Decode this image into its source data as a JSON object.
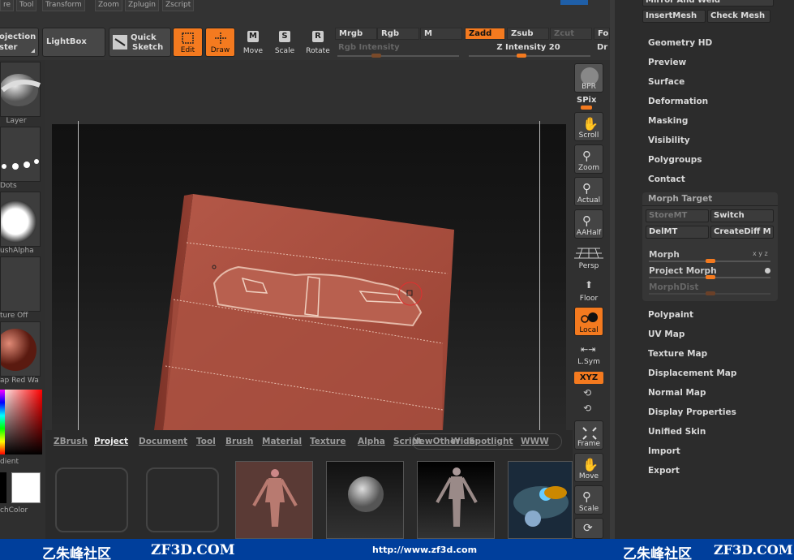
{
  "menu": {
    "items": [
      "re",
      "Tool",
      "Transform",
      "Zoom",
      "Zplugin",
      "Zscript"
    ]
  },
  "toolbar": {
    "projection_label_1": "ojection",
    "projection_label_2": "ster",
    "lightbox": "LightBox",
    "quick_sketch_1": "Quick",
    "quick_sketch_2": "Sketch",
    "edit": "Edit",
    "draw": "Draw",
    "move": "Move",
    "scale": "Scale",
    "rotate": "Rotate",
    "mrgb": "Mrgb",
    "rgb": "Rgb",
    "m": "M",
    "zadd": "Zadd",
    "zsub": "Zsub",
    "zcut": "Zcut",
    "fo": "Fo",
    "rgb_intensity": "Rgb Intensity",
    "z_intensity": "Z Intensity 20",
    "dr": "Dr"
  },
  "left": {
    "layer": "Layer",
    "dots": "Dots",
    "brush_alpha": "ushAlpha",
    "texture_off": "ture Off",
    "material": "ap Red Wa",
    "gradient": "dient",
    "switch_color": "chColor"
  },
  "right_tools": {
    "bpr": "BPR",
    "spix": "SPix",
    "scroll": "Scroll",
    "zoom": "Zoom",
    "actual": "Actual",
    "aahalf": "AAHalf",
    "persp": "Persp",
    "floor": "Floor",
    "local": "Local",
    "lsym": "L.Sym",
    "xyz": "XYZ",
    "frame": "Frame",
    "move": "Move",
    "scale": "Scale"
  },
  "tray": {
    "tabs": [
      "ZBrush",
      "Project",
      "Document",
      "Tool",
      "Brush",
      "Material",
      "Texture",
      "Alpha",
      "Script",
      "NewOther",
      "Wide",
      "Spotlight",
      "WWW"
    ]
  },
  "palette": {
    "mirror_weld": "Mirror And Weld",
    "insert_mesh": "InsertMesh",
    "check_mesh": "Check Mesh",
    "geometry_hd": "Geometry HD",
    "preview": "Preview",
    "surface": "Surface",
    "deformation": "Deformation",
    "masking": "Masking",
    "visibility": "Visibility",
    "polygroups": "Polygroups",
    "contact": "Contact",
    "morph_target": "Morph Target",
    "storemt": "StoreMT",
    "switch": "Switch",
    "delmt": "DelMT",
    "creatediff": "CreateDiff M",
    "morph": "Morph",
    "project_morph": "Project Morph",
    "morphdist": "MorphDist",
    "polypaint": "Polypaint",
    "uv_map": "UV Map",
    "texture_map": "Texture Map",
    "displacement_map": "Displacement Map",
    "normal_map": "Normal Map",
    "display_properties": "Display Properties",
    "unified_skin": "Unified Skin",
    "import": "Import",
    "export": "Export"
  },
  "footer": {
    "logo_left": "乙朱峰社区",
    "site_left": "ZF3D.COM",
    "url": "http://www.zf3d.com",
    "logo_right": "乙朱峰社区",
    "site_right": "ZF3D.COM"
  },
  "colors": {
    "accent": "#f47a1f",
    "clay": "#a84c3c",
    "footer": "#003f9c"
  }
}
